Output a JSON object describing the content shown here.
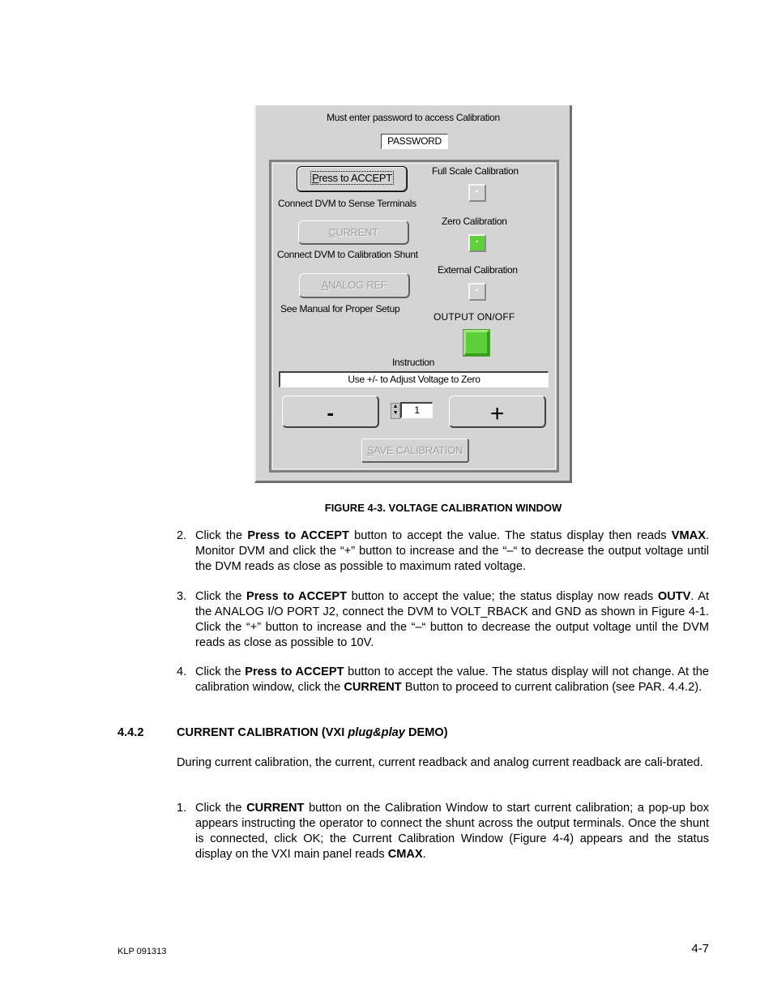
{
  "calibration_window": {
    "password_prompt": "Must enter password to access Calibration",
    "password_value": "PASSWORD",
    "buttons": {
      "accept": {
        "label": "Press to ACCEPT",
        "mnemonic": "P",
        "rest": "ress to ACCEPT",
        "state": "active"
      },
      "current": {
        "label": "CURRENT",
        "mnemonic": "C",
        "rest": "URRENT",
        "state": "disabled"
      },
      "analog_ref": {
        "label": "ANALOG REF",
        "mnemonic": "A",
        "rest": "NALOG REF",
        "state": "disabled"
      },
      "minus": {
        "label": "-"
      },
      "plus": {
        "label": "+"
      },
      "save": {
        "label": "SAVE CALIBRATION",
        "mnemonic": "S",
        "rest": "AVE CALIBRATION",
        "state": "disabled"
      }
    },
    "hints": {
      "accept": "Connect DVM to Sense Terminals",
      "current": "Connect DVM to Calibration Shunt",
      "analog_ref": "See Manual for Proper Setup"
    },
    "indicators": [
      {
        "label": "Full Scale Calibration",
        "state": "off"
      },
      {
        "label": "Zero Calibration",
        "state": "on"
      },
      {
        "label": "External Calibration",
        "state": "off"
      }
    ],
    "output_toggle": {
      "label": "OUTPUT ON/OFF",
      "state": "on"
    },
    "instruction": {
      "label": "Instruction",
      "value": "Use +/- to Adjust Voltage to Zero"
    },
    "step_value": "1",
    "colors": {
      "panel": "#d4d4d4",
      "led_on": "#5ed03a"
    }
  },
  "document": {
    "figure_caption": "FIGURE 4-3.  VOLTAGE CALIBRATION WINDOW",
    "steps_voltage": [
      {
        "num": "2.",
        "parts": [
          {
            "t": "Click the ",
            "b": false
          },
          {
            "t": "Press to ACCEPT",
            "b": true
          },
          {
            "t": " button to accept the value. The status display then reads ",
            "b": false
          },
          {
            "t": "VMAX",
            "b": true
          },
          {
            "t": ". Monitor DVM and click the “+” button to increase and the “–“ to decrease the output voltage until the DVM reads as close as possible to maximum rated voltage.",
            "b": false
          }
        ]
      },
      {
        "num": "3.",
        "parts": [
          {
            "t": "Click the ",
            "b": false
          },
          {
            "t": "Press to ACCEPT",
            "b": true
          },
          {
            "t": " button to accept the value; the status display now reads ",
            "b": false
          },
          {
            "t": "OUTV",
            "b": true
          },
          {
            "t": ". At the ANALOG I/O PORT J2, connect the DVM to VOLT_RBACK and GND as shown in Figure 4-1. Click the “+” button to increase and the “–“ button to decrease the output voltage until the DVM reads as close as possible to 10V.",
            "b": false
          }
        ]
      },
      {
        "num": "4.",
        "parts": [
          {
            "t": "Click the ",
            "b": false
          },
          {
            "t": "Press to ACCEPT",
            "b": true
          },
          {
            "t": " button to accept the value. The status display will not change. At the calibration window, click the ",
            "b": false
          },
          {
            "t": "CURRENT",
            "b": true
          },
          {
            "t": " Button to proceed to current calibration (see PAR. 4.4.2).",
            "b": false
          }
        ]
      }
    ],
    "section": {
      "number": "4.4.2",
      "title_pre": "CURRENT CALIBRATION (VXI ",
      "title_italic": "plug&play",
      "title_post": " DEMO)"
    },
    "section_intro": "During current calibration, the current, current readback and analog current readback are cali-brated.",
    "steps_current": [
      {
        "num": "1.",
        "parts": [
          {
            "t": "Click the ",
            "b": false
          },
          {
            "t": "CURRENT",
            "b": true
          },
          {
            "t": " button on the Calibration Window to start current calibration; a pop-up box appears instructing the operator to connect the shunt across the output terminals. Once the shunt is connected, click OK; the Current Calibration Window (Figure 4-4) appears and the status display on the VXI main panel reads ",
            "b": false
          },
          {
            "t": "CMAX",
            "b": true
          },
          {
            "t": ".",
            "b": false
          }
        ]
      }
    ],
    "footer": {
      "doc_id": "KLP 091313",
      "page": "4-7"
    }
  }
}
